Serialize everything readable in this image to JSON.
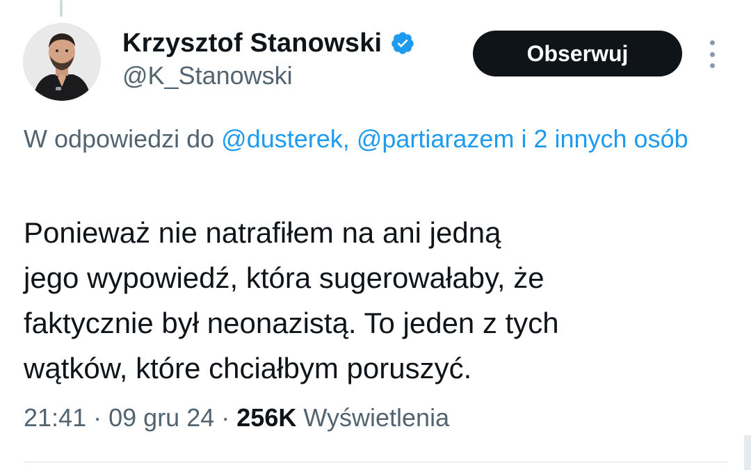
{
  "author": {
    "display_name": "Krzysztof Stanowski",
    "handle": "@K_Stanowski",
    "verified": true
  },
  "actions": {
    "follow_label": "Obserwuj"
  },
  "reply_context": {
    "prefix": "W odpowiedzi do",
    "mention_1": "@dusterek,",
    "mention_2": "@partiarazem",
    "connector": "i",
    "others_link": "2 innych osób"
  },
  "tweet": {
    "lines": [
      "Ponieważ nie natrafiłem na ani jedną",
      "jego wypowiedź, która sugerowałaby, że",
      "faktycznie był neonazistą. To jeden z tych",
      "wątków, które chciałbym poruszyć."
    ]
  },
  "meta": {
    "time": "21:41",
    "separator": "·",
    "date": "09 gru 24",
    "views_count": "256K",
    "views_label": "Wyświetlenia"
  },
  "colors": {
    "accent": "#1d9bf0",
    "text_primary": "#0f1419",
    "text_secondary": "#536471",
    "button_bg": "#0f1419",
    "verified": "#1d9bf0"
  },
  "icons": {
    "verified": "verified-badge-icon",
    "more": "more-vertical-icon"
  }
}
